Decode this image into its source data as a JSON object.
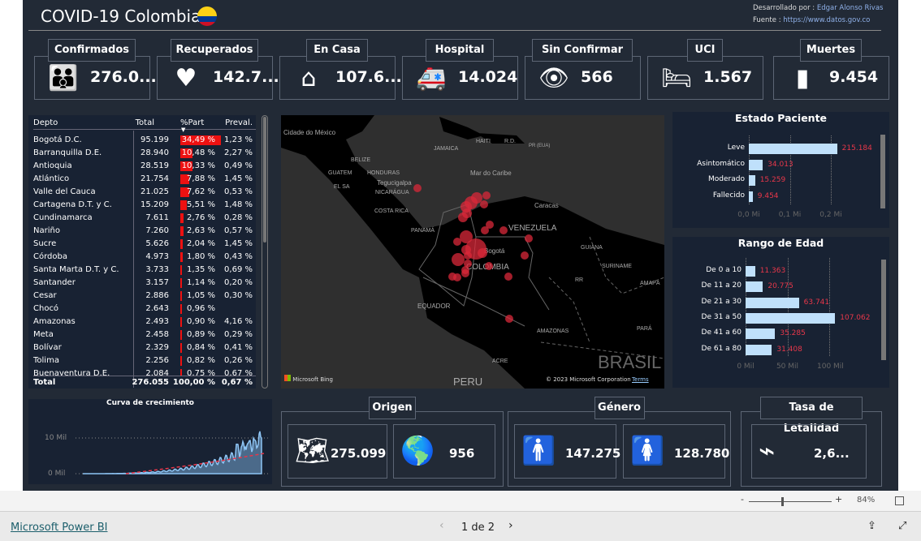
{
  "header": {
    "title": "COVID-19 Colombia",
    "flag_icon": "colombia-flag-icon",
    "dev_label": "Desarrollado por :",
    "dev_name": "Edgar Alonso Rivas",
    "source_label": "Fuente :",
    "source_url": "https://www.datos.gov.co"
  },
  "kpis": [
    {
      "label": "Confirmados",
      "value": "276.0...",
      "icon": "people-growth-icon"
    },
    {
      "label": "Recuperados",
      "value": "142.7...",
      "icon": "heart-pulse-icon"
    },
    {
      "label": "En Casa",
      "value": "107.6...",
      "icon": "house-icon"
    },
    {
      "label": "Hospital",
      "value": "14.024",
      "icon": "ambulance-icon"
    },
    {
      "label": "Sin Confirmar",
      "value": "566",
      "icon": "search-person-icon"
    },
    {
      "label": "UCI",
      "value": "1.567",
      "icon": "bed-icon"
    },
    {
      "label": "Muertes",
      "value": "9.454",
      "icon": "tombstone-icon"
    }
  ],
  "table": {
    "headers": [
      "Depto",
      "Total",
      "%Part",
      "Preval."
    ],
    "rows": [
      [
        "Bogotá D.C.",
        "95.199",
        "34,49 %",
        "1,23 %",
        34.49
      ],
      [
        "Barranquilla D.E.",
        "28.940",
        "10,48 %",
        "2,27 %",
        10.48
      ],
      [
        "Antioquia",
        "28.519",
        "10,33 %",
        "0,49 %",
        10.33
      ],
      [
        "Atlántico",
        "21.754",
        "7,88 %",
        "1,45 %",
        7.88
      ],
      [
        "Valle del Cauca",
        "21.025",
        "7,62 %",
        "0,53 %",
        7.62
      ],
      [
        "Cartagena D.T. y C.",
        "15.209",
        "5,51 %",
        "1,48 %",
        5.51
      ],
      [
        "Cundinamarca",
        "7.611",
        "2,76 %",
        "0,28 %",
        2.76
      ],
      [
        "Nariño",
        "7.260",
        "2,63 %",
        "0,57 %",
        2.63
      ],
      [
        "Sucre",
        "5.626",
        "2,04 %",
        "1,45 %",
        2.04
      ],
      [
        "Córdoba",
        "4.973",
        "1,80 %",
        "0,43 %",
        1.8
      ],
      [
        "Santa Marta D.T. y C.",
        "3.733",
        "1,35 %",
        "0,69 %",
        1.35
      ],
      [
        "Santander",
        "3.157",
        "1,14 %",
        "0,20 %",
        1.14
      ],
      [
        "Cesar",
        "2.886",
        "1,05 %",
        "0,30 %",
        1.05
      ],
      [
        "Chocó",
        "2.643",
        "0,96 %",
        "",
        0.96
      ],
      [
        "Amazonas",
        "2.493",
        "0,90 %",
        "4,16 %",
        0.9
      ],
      [
        "Meta",
        "2.458",
        "0,89 %",
        "0,29 %",
        0.89
      ],
      [
        "Bolívar",
        "2.329",
        "0,84 %",
        "0,41 %",
        0.84
      ],
      [
        "Tolima",
        "2.256",
        "0,82 %",
        "0,26 %",
        0.82
      ],
      [
        "Buenaventura D.E.",
        "2.084",
        "0,75 %",
        "0,67 %",
        0.75
      ]
    ],
    "total": [
      "Total",
      "276.055",
      "100,00 %",
      "0,67 %"
    ],
    "bar_color": "#ee1111"
  },
  "map": {
    "labels": [
      "Cidade do México",
      "JAMAICA",
      "HAITI",
      "R.D.",
      "PR (EUA)",
      "BELIZE",
      "GUATEM",
      "HONDURAS",
      "Tegucigalpa",
      "EL SA",
      "NICARÁGUA",
      "Mar do Caribe",
      "Caracas",
      "COSTA RICA",
      "VENEZUELA",
      "PANAMÁ",
      "Bogotá",
      "GUIANA",
      "COLOMBIA",
      "SURINAME",
      "RR",
      "AMAPÁ",
      "EQUADOR",
      "AMAZONAS",
      "PARÁ",
      "BRASIL",
      "ACRE",
      "PERU"
    ],
    "bing": "Microsoft Bing",
    "copyright": "© 2023 Microsoft Corporation",
    "terms": "Terms",
    "bubble_color": "#d9283a"
  },
  "estado": {
    "title": "Estado Paciente",
    "categories": [
      "Leve",
      "Asintomático",
      "Moderado",
      "Fallecido"
    ],
    "values": [
      215184,
      34013,
      15259,
      9454
    ],
    "value_labels": [
      "215.184",
      "34.013",
      "15.259",
      "9.454"
    ],
    "ticks": [
      "0,0 Mi",
      "0,1 Mi",
      "0,2 Mi"
    ],
    "xmax": 0.2,
    "bar_color": "#bfe0fb",
    "label_color": "#e8374a"
  },
  "edad": {
    "title": "Rango de Edad",
    "categories": [
      "De 0 a 10",
      "De 11 a 20",
      "De 21 a 30",
      "De 31 a 50",
      "De 41 a 60",
      "De 61 a 80"
    ],
    "values": [
      11363,
      20775,
      63741,
      107062,
      35285,
      31408
    ],
    "value_labels": [
      "11.363",
      "20.775",
      "63.741",
      "107.062",
      "35.285",
      "31.408"
    ],
    "ticks": [
      "0 Mil",
      "50 Mil",
      "100 Mil"
    ]
  },
  "curva": {
    "title": "Curva de crecimiento",
    "ticks": [
      "10 Mil",
      "0 Mil"
    ]
  },
  "origen": {
    "title": "Origen",
    "items": [
      {
        "icon": "colombia-map-icon",
        "value": "275.099"
      },
      {
        "icon": "globe-icon",
        "value": "956"
      }
    ]
  },
  "genero": {
    "title": "Género",
    "items": [
      {
        "icon": "male-icon",
        "value": "147.275"
      },
      {
        "icon": "female-icon",
        "value": "128.780"
      }
    ]
  },
  "letalidad": {
    "title": "Tasa de Letalidad",
    "icon": "heartbeat-line-icon",
    "value": "2,6..."
  },
  "footer": {
    "zoom": "84%",
    "minus": "-",
    "plus": "+",
    "brand": "Microsoft Power BI",
    "page": "1 de 2"
  }
}
